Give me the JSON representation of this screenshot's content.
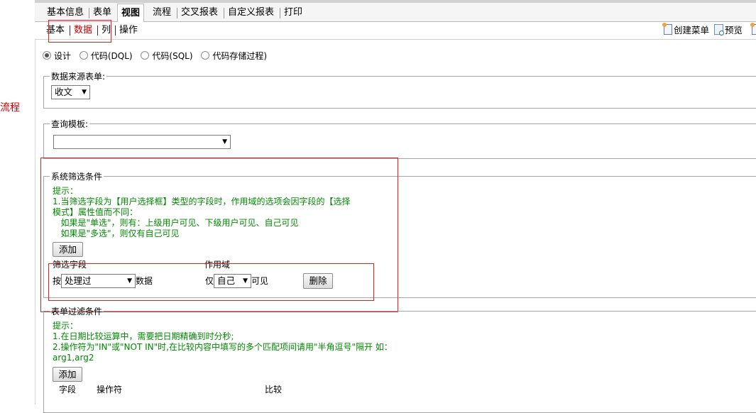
{
  "left_word": "流程",
  "tabs": [
    {
      "label": "基本信息"
    },
    {
      "label": "表单"
    },
    {
      "label": "视图"
    },
    {
      "label": "流程"
    },
    {
      "label": "交叉报表"
    },
    {
      "label": "自定义报表"
    },
    {
      "label": "打印"
    }
  ],
  "subtabs": [
    {
      "label": "基本"
    },
    {
      "label": "数据"
    },
    {
      "label": "列"
    },
    {
      "label": "操作"
    }
  ],
  "toolbar": {
    "create_menu": "创建菜单",
    "preview": "预览"
  },
  "data_mode": {
    "options": [
      "设计",
      "代码(DQL)",
      "代码(SQL)",
      "代码存储过程)"
    ],
    "selected": "设计"
  },
  "source_form": {
    "legend": "数据来源表单:",
    "selected": "收文"
  },
  "query_template": {
    "legend": "查询模板:",
    "selected": ""
  },
  "system_filter": {
    "legend": "系统筛选条件",
    "hint_lines": [
      "提示：",
      "1.当筛选字段为【用户选择框】类型的字段时，作用域的选项会因字段的【选择",
      "模式】属性值而不同：",
      "   如果是\"单选\"，则有：上级用户可见、下级用户可见、自己可见",
      "   如果是\"多选\"，则仅有自己可见"
    ],
    "add_label": "添加",
    "col_field": "筛选字段",
    "col_scope": "作用域",
    "row": {
      "prefix": "按",
      "field_value": "处理过",
      "suffix": "数据",
      "scope_prefix": "仅",
      "scope_value": "自己",
      "scope_suffix": "可见",
      "delete_label": "删除"
    }
  },
  "form_filter": {
    "legend": "表单过滤条件",
    "hint_lines": [
      "提示：",
      "1.在日期比较运算中，需要把日期精确到时分秒;",
      "2.操作符为\"IN\"或\"NOT IN\"时,在比较内容中填写的多个匹配项间请用\"半角逗号\"隔开 如：",
      "arg1,arg2"
    ],
    "add_label": "添加",
    "headers": [
      "字段",
      "操作符",
      "比较"
    ]
  }
}
